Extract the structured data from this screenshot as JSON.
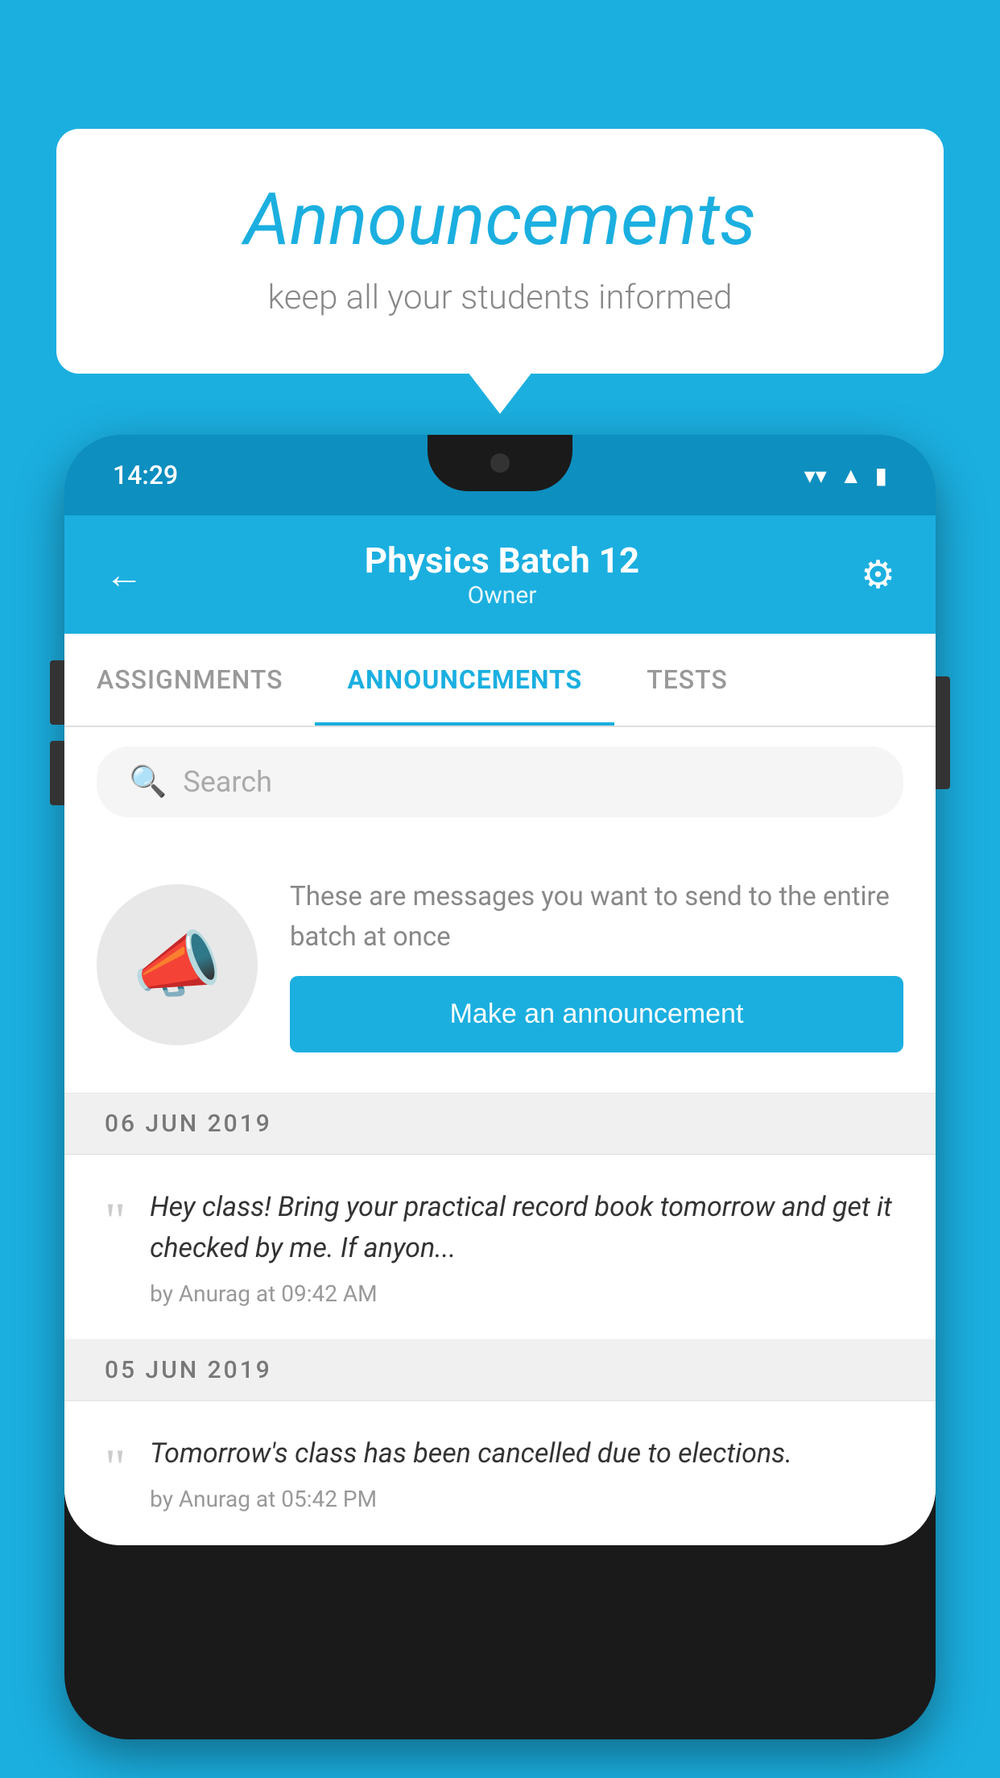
{
  "background_color": "#1BAFE0",
  "speech_bubble": {
    "title": "Announcements",
    "subtitle": "keep all your students informed"
  },
  "phone": {
    "status_bar": {
      "time": "14:29",
      "icons": [
        "wifi",
        "signal",
        "battery"
      ]
    },
    "header": {
      "title": "Physics Batch 12",
      "subtitle": "Owner",
      "back_label": "←",
      "gear_label": "⚙"
    },
    "tabs": [
      {
        "label": "ASSIGNMENTS",
        "active": false
      },
      {
        "label": "ANNOUNCEMENTS",
        "active": true
      },
      {
        "label": "TESTS",
        "active": false
      },
      {
        "label": "...",
        "active": false
      }
    ],
    "search": {
      "placeholder": "Search"
    },
    "announcement_prompt": {
      "description": "These are messages you want to send to the entire batch at once",
      "button_label": "Make an announcement"
    },
    "announcements": [
      {
        "date": "06  JUN  2019",
        "message": "Hey class! Bring your practical record book tomorrow and get it checked by me. If anyon...",
        "meta": "by Anurag at 09:42 AM"
      },
      {
        "date": "05  JUN  2019",
        "message": "Tomorrow's class has been cancelled due to elections.",
        "meta": "by Anurag at 05:42 PM"
      }
    ]
  }
}
